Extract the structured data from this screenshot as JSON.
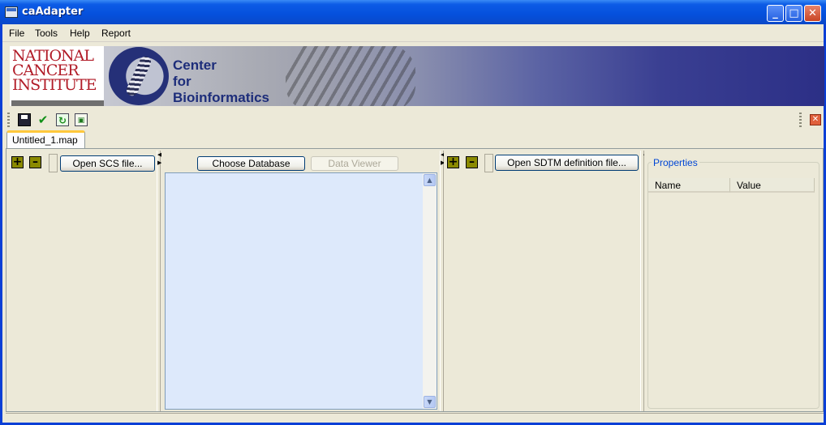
{
  "window": {
    "title": "caAdapter"
  },
  "menu": [
    "File",
    "Tools",
    "Help",
    "Report"
  ],
  "banner": {
    "nci_lines": [
      "NATIONAL",
      "CANCER",
      "INSTITUTE"
    ],
    "center_lines": [
      "Center",
      "for",
      "Bioinformatics"
    ]
  },
  "toolbar": {
    "icons": [
      "save-icon",
      "spellcheck-icon",
      "refresh-icon",
      "validate-icon"
    ],
    "close_icon": "close-icon"
  },
  "tab": {
    "label": "Untitled_1.map"
  },
  "source_panel": {
    "open_button": "Open SCS file..."
  },
  "middle_panel": {
    "choose_db_button": "Choose Database",
    "data_viewer_button": "Data Viewer"
  },
  "target_panel": {
    "open_button": "Open SDTM definition file..."
  },
  "properties": {
    "title": "Properties",
    "columns": [
      "Name",
      "Value"
    ]
  },
  "colors": {
    "accent": "#0046d5",
    "banner_dark": "#2c2f86",
    "nci_red": "#b11c28"
  }
}
